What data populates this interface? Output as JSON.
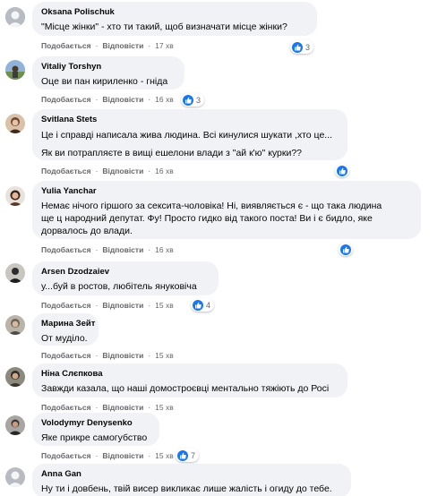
{
  "labels": {
    "like": "Подобається",
    "reply": "Відповісти"
  },
  "colors": {
    "bubble": "#f0f2f5",
    "like_blue": "#1877f2",
    "meta": "#65676b"
  },
  "comments": [
    {
      "author": "Oksana Polischuk",
      "text": [
        "\"Місце жінки\" - хто ти такий, щоб визначати місце жінки?"
      ],
      "time": "17 хв",
      "reactions": "3"
    },
    {
      "author": "Vitaliy Torshyn",
      "text": [
        "Оце ви пан кириленко - гніда"
      ],
      "time": "16 хв",
      "reactions": "3"
    },
    {
      "author": "Svitlana Stets",
      "text": [
        "Це і справді написала жива людина. Всі кинулися шукати ,хто це...",
        "Як ви потрапляєте в вищі ешелони влади з \"ай к'ю\" курки??"
      ],
      "time": "16 хв",
      "reactions": ""
    },
    {
      "author": "Yulia Yanchar",
      "text": [
        "Немає нічого гіршого за сексита-чоловіка! Ні, виявляється є - що така людина",
        "ще ц народний депутат. Фу! Просто гидко від такого поста! Ви і є бидло, яке",
        "дорвалось до влади."
      ],
      "time": "16 хв",
      "reactions": ""
    },
    {
      "author": "Arsen Dzodzaiev",
      "text": [
        "у...буй в ростов, любітель януковіча"
      ],
      "time": "15 хв",
      "reactions": "4"
    },
    {
      "author": "Марина Зейт",
      "text": [
        "От муділо."
      ],
      "time": "15 хв",
      "reactions": ""
    },
    {
      "author": "Ніна Слєпкова",
      "text": [
        "Завжди казала, що наші домостроєвці ментально тяжіють до Росі"
      ],
      "time": "15 хв",
      "reactions": ""
    },
    {
      "author": "Volodymyr Denysenko",
      "text": [
        "Яке прикре самогубство"
      ],
      "time": "15 хв",
      "reactions": "7"
    },
    {
      "author": "Anna Gan",
      "text": [
        "Ну ти і довбень, твій висер викликає лише жалість і огиду до тебе."
      ],
      "time": "",
      "reactions": ""
    }
  ]
}
